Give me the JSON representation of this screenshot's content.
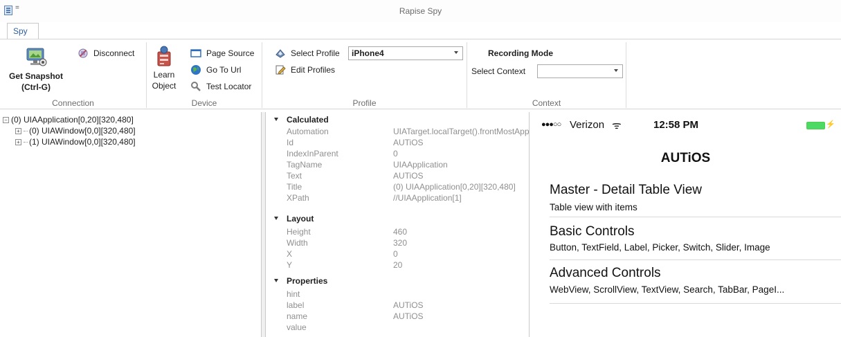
{
  "window": {
    "title": "Rapise Spy",
    "qa_dropdown": "="
  },
  "ribbon": {
    "tab": "Spy",
    "connection": {
      "label": "Connection",
      "get_snapshot": "Get Snapshot",
      "get_snapshot_shortcut": "(Ctrl-G)",
      "disconnect": "Disconnect"
    },
    "device": {
      "label": "Device",
      "learn_object_line1": "Learn",
      "learn_object_line2": "Object",
      "page_source": "Page Source",
      "go_to_url": "Go To Url",
      "test_locator": "Test Locator"
    },
    "profile": {
      "label": "Profile",
      "select_profile": "Select Profile",
      "selected_profile": "iPhone4",
      "edit_profiles": "Edit Profiles"
    },
    "context": {
      "label": "Context",
      "recording_mode": "Recording Mode",
      "select_context": "Select Context",
      "selected_context": ""
    }
  },
  "tree": {
    "root": "(0) UIAApplication[0,20][320,480]",
    "children": [
      "(0) UIAWindow[0,0][320,480]",
      "(1) UIAWindow[0,0][320,480]"
    ]
  },
  "properties": {
    "calculated": {
      "header": "Calculated",
      "rows": [
        {
          "key": "Automation",
          "value": "UIATarget.localTarget().frontMostApp"
        },
        {
          "key": "Id",
          "value": "AUTiOS"
        },
        {
          "key": "IndexInParent",
          "value": "0"
        },
        {
          "key": "TagName",
          "value": "UIAApplication"
        },
        {
          "key": "Text",
          "value": "AUTiOS"
        },
        {
          "key": "Title",
          "value": "(0) UIAApplication[0,20][320,480]"
        },
        {
          "key": "XPath",
          "value": "//UIAApplication[1]"
        }
      ]
    },
    "layout": {
      "header": "Layout",
      "rows": [
        {
          "key": "Height",
          "value": "460"
        },
        {
          "key": "Width",
          "value": "320"
        },
        {
          "key": "X",
          "value": "0"
        },
        {
          "key": "Y",
          "value": "20"
        }
      ]
    },
    "props": {
      "header": "Properties",
      "rows": [
        {
          "key": "hint",
          "value": ""
        },
        {
          "key": "label",
          "value": "AUTiOS"
        },
        {
          "key": "name",
          "value": "AUTiOS"
        },
        {
          "key": "value",
          "value": ""
        }
      ]
    }
  },
  "phone": {
    "signal": "●●●○○",
    "carrier": "Verizon",
    "wifi": "ᯤ",
    "time": "12:58 PM",
    "battery_charge": "⚡",
    "nav_title": "AUTiOS",
    "cells": [
      {
        "title": "Master - Detail Table View",
        "subtitle": "Table view with items"
      },
      {
        "title": "Basic Controls",
        "subtitle": "Button, TextField, Label, Picker, Switch, Slider, Image"
      },
      {
        "title": "Advanced Controls",
        "subtitle": "WebView, ScrollView, TextView, Search, TabBar, PageI..."
      }
    ]
  }
}
